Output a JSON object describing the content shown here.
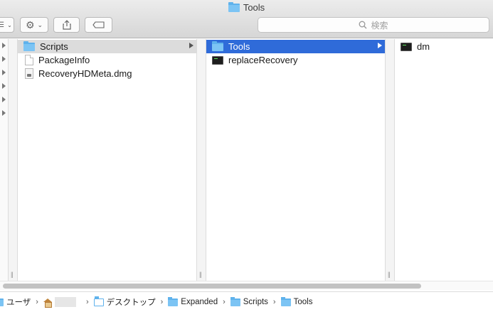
{
  "window": {
    "title": "Tools"
  },
  "toolbar": {
    "view_menu_icon": "list-view-icon",
    "action_icon": "gear-icon",
    "share_icon": "share-icon",
    "tag_icon": "tag-icon",
    "search_placeholder": "検索"
  },
  "columns": [
    {
      "items": [
        {
          "label": "Scripts",
          "icon": "folder-icon",
          "selected": "inactive",
          "has_children": true
        },
        {
          "label": "PackageInfo",
          "icon": "document-icon"
        },
        {
          "label": "RecoveryHDMeta.dmg",
          "icon": "disk-image-icon"
        }
      ]
    },
    {
      "items": [
        {
          "label": "Tools",
          "icon": "folder-icon",
          "selected": "active",
          "has_children": true
        },
        {
          "label": "replaceRecovery",
          "icon": "terminal-icon"
        }
      ]
    },
    {
      "items": [
        {
          "label": "dm",
          "icon": "terminal-icon"
        }
      ]
    }
  ],
  "pathbar": {
    "crumbs": [
      "ユーザ",
      "",
      "デスクトップ",
      "Expanded",
      "Scripts",
      "Tools"
    ]
  }
}
